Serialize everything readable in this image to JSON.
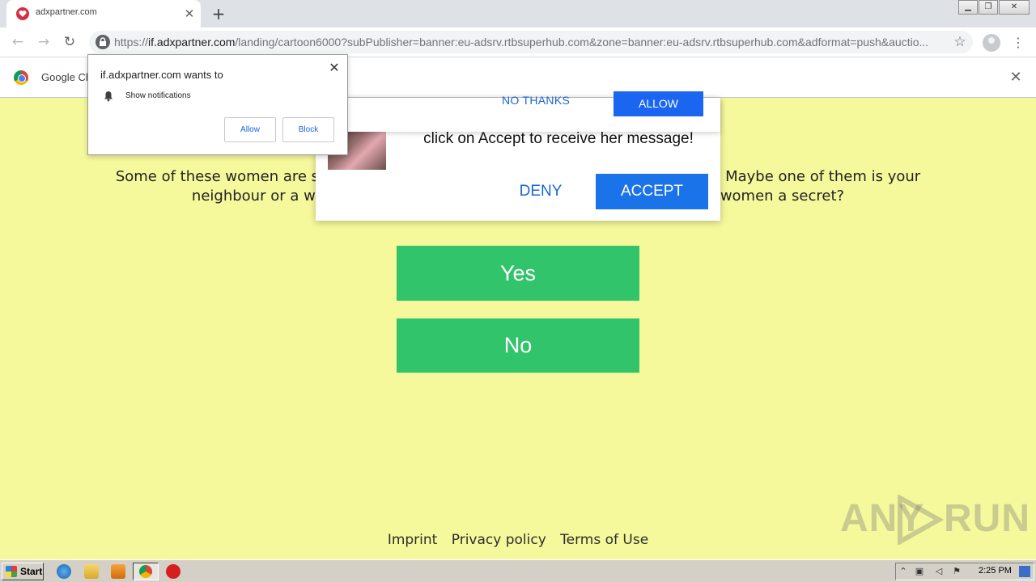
{
  "browser": {
    "tab_title": "adxpartner.com",
    "url_scheme": "https://",
    "url_host": "if.adxpartner.com",
    "url_path": "/landing/cartoon6000?subPublisher=banner:eu-adsrv.rtbsuperhub.com&zone=banner:eu-adsrv.rtbsuperhub.com&adformat=push&auctio...",
    "infobar_text": "Google Ch",
    "icons": {
      "favicon": "heart-icon",
      "close": "close-icon",
      "new_tab": "plus-icon",
      "back": "back-arrow-icon",
      "forward": "forward-arrow-icon",
      "reload": "reload-icon",
      "lock": "lock-icon",
      "bookmark": "star-icon",
      "profile": "profile-icon",
      "menu": "kebab-menu-icon"
    }
  },
  "permission_prompt": {
    "title": "if.adxpartner.com wants to",
    "item": "Show notifications",
    "allow_label": "Allow",
    "block_label": "Block"
  },
  "overlay": {
    "no_thanks_label": "NO THANKS",
    "allow_label": "ALLOW",
    "message": "click on Accept to receive her message!",
    "deny_label": "DENY",
    "accept_label": "ACCEPT"
  },
  "page": {
    "intro_line1_left": "Some of these women are single",
    "intro_line1_right": "time. Maybe one of them is your",
    "intro_line2_left": "neighbour or a w",
    "intro_line2_right": "women a secret?",
    "yes_label": "Yes",
    "no_label": "No",
    "footer": {
      "imprint": "Imprint",
      "privacy": "Privacy policy",
      "terms": "Terms of Use"
    },
    "watermark_left": "ANY",
    "watermark_right": "RUN"
  },
  "taskbar": {
    "start_label": "Start",
    "clock": "2:25 PM"
  },
  "colors": {
    "page_bg": "#f5f89b",
    "answer_green": "#31c46a",
    "accept_blue": "#1a73e8",
    "link_blue": "#1a66d6"
  }
}
